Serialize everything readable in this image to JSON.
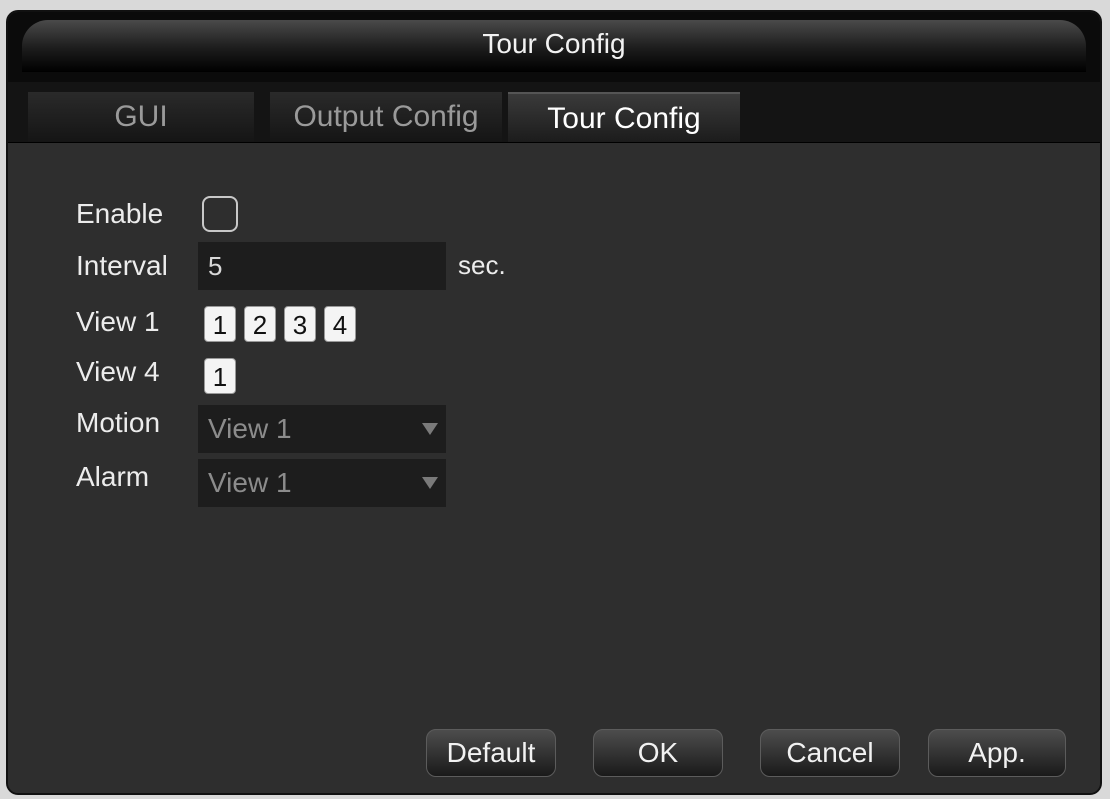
{
  "window": {
    "title": "Tour Config"
  },
  "tabs": [
    {
      "label": "GUI"
    },
    {
      "label": "Output Config"
    },
    {
      "label": "Tour Config"
    }
  ],
  "form": {
    "enable": {
      "label": "Enable",
      "checked": false
    },
    "interval": {
      "label": "Interval",
      "value": "5",
      "unit": "sec."
    },
    "view1": {
      "label": "View 1",
      "options": [
        "1",
        "2",
        "3",
        "4"
      ]
    },
    "view4": {
      "label": "View 4",
      "options": [
        "1"
      ]
    },
    "motion": {
      "label": "Motion",
      "value": "View 1"
    },
    "alarm": {
      "label": "Alarm",
      "value": "View 1"
    }
  },
  "buttons": {
    "default": "Default",
    "ok": "OK",
    "cancel": "Cancel",
    "apply": "App."
  }
}
